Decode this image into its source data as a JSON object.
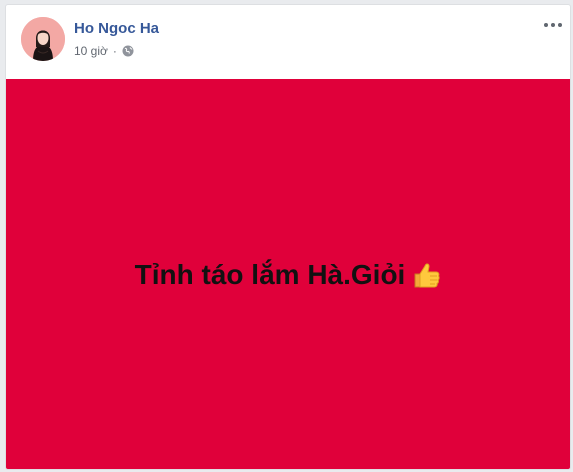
{
  "post": {
    "author": "Ho Ngoc Ha",
    "time": "10 giờ",
    "separator": "·",
    "privacy_icon": "globe-icon",
    "menu_icon": "more-options-icon",
    "background_color": "#e0003a",
    "status_text": "Tỉnh táo lắm Hà.Giỏi",
    "emoji_icon": "thumbs-up-icon"
  }
}
